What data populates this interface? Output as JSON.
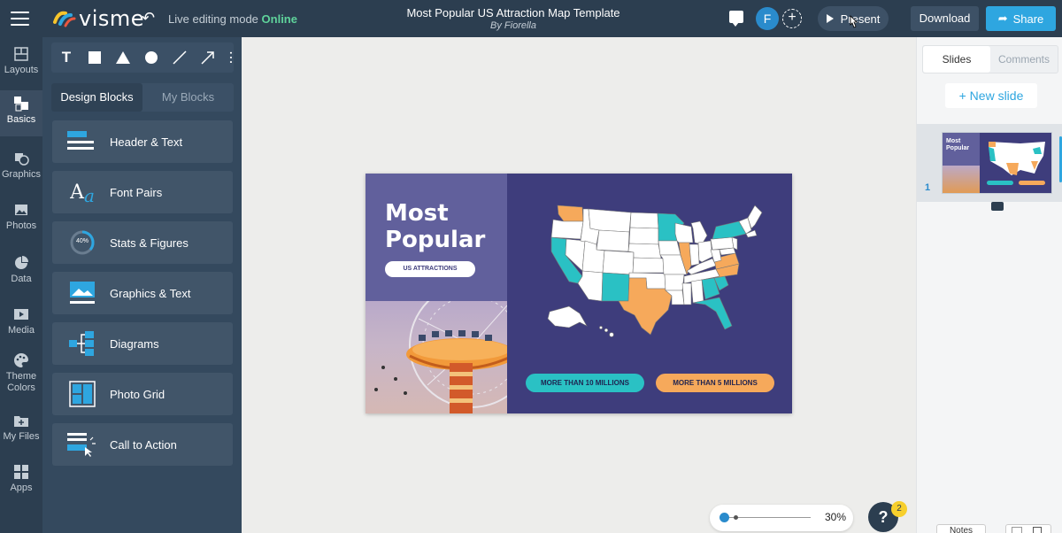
{
  "app": {
    "logo": "visme",
    "mode_label": "Live editing mode",
    "mode_status": "Online",
    "doc_title": "Most Popular US Attraction Map Template",
    "doc_author": "By Fiorella",
    "avatar_initial": "F",
    "present_label": "Present",
    "download_label": "Download",
    "share_label": "Share"
  },
  "rail": {
    "items": [
      {
        "label": "Layouts",
        "icon": "layouts-icon"
      },
      {
        "label": "Basics",
        "icon": "basics-icon"
      },
      {
        "label": "Graphics",
        "icon": "graphics-icon"
      },
      {
        "label": "Photos",
        "icon": "photos-icon"
      },
      {
        "label": "Data",
        "icon": "pie-chart-icon"
      },
      {
        "label": "Media",
        "icon": "media-icon"
      },
      {
        "label": "Theme Colors",
        "icon": "palette-icon"
      },
      {
        "label": "My Files",
        "icon": "folder-icon"
      },
      {
        "label": "Apps",
        "icon": "apps-icon"
      }
    ]
  },
  "panel": {
    "tabs": [
      "Design Blocks",
      "My Blocks"
    ],
    "blocks": [
      "Header & Text",
      "Font Pairs",
      "Stats & Figures",
      "Graphics & Text",
      "Diagrams",
      "Photo Grid",
      "Call to Action"
    ],
    "stats_icon_text": "40%"
  },
  "slide": {
    "title_line1": "Most",
    "title_line2": "Popular",
    "subtitle": "US ATTRACTIONS",
    "pill_teal": "MORE THAN 10 MILLIONS",
    "pill_orange": "MORE THAN 5 MILLIONS",
    "colors": {
      "background": "#3e3d7c",
      "teal": "#2ac1c4",
      "orange": "#f6a95b",
      "panel": "#61609c"
    }
  },
  "zoom": {
    "level": "30%"
  },
  "help": {
    "label": "?",
    "badge": "2"
  },
  "right_panel": {
    "tabs": [
      "Slides",
      "Comments"
    ],
    "new_slide": "+ New slide",
    "slide_number": "1",
    "thumb_title": "Most Popular",
    "notes_label": "Notes"
  }
}
